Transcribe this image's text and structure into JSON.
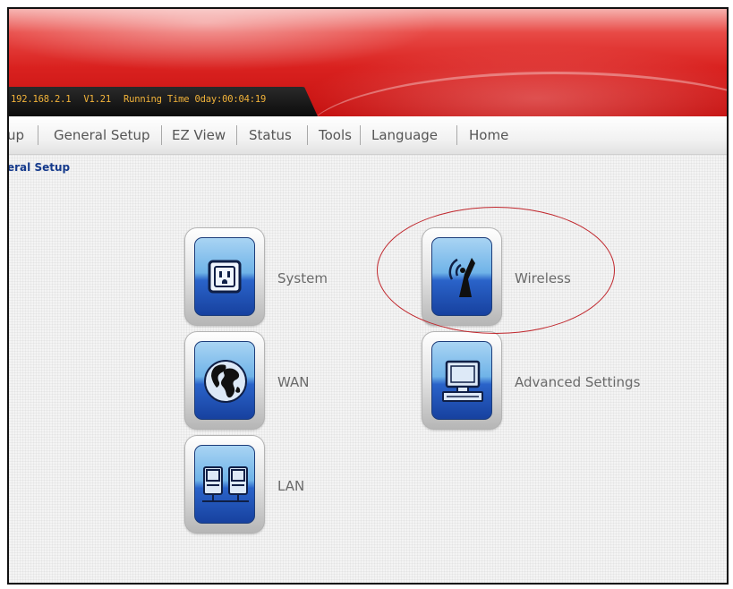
{
  "status_bar": {
    "ip": "192.168.2.1",
    "version": "V1.21",
    "running_time": "Running Time 0day:00:04:19"
  },
  "nav": {
    "items": [
      "up",
      "General Setup",
      "EZ View",
      "Status",
      "Tools",
      "Language",
      "Home"
    ]
  },
  "breadcrumb": "eral Setup",
  "tiles": {
    "system": "System",
    "wan": "WAN",
    "lan": "LAN",
    "wireless": "Wireless",
    "advanced": "Advanced Settings"
  },
  "colors": {
    "banner_red": "#d9211f",
    "status_text": "#f2b33a",
    "breadcrumb": "#153a8c",
    "tile_blue": "#2a63c9",
    "highlight_circle": "#c0272d"
  },
  "icons": {
    "system": "power-outlet-icon",
    "wan": "globe-icon",
    "lan": "network-computers-icon",
    "wireless": "satellite-dish-icon",
    "advanced": "computer-monitor-icon"
  }
}
